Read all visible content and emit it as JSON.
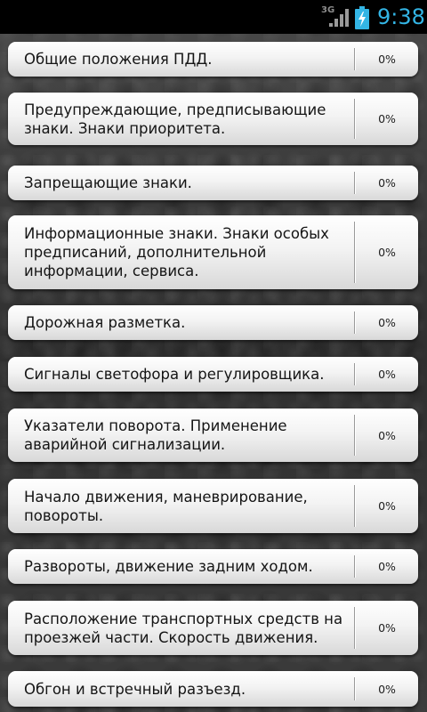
{
  "status_bar": {
    "network": "3G",
    "time": "9:38",
    "signal_icon": "signal-bars-icon",
    "battery_icon": "battery-charging-icon",
    "accent_color": "#33b5e5"
  },
  "topics": [
    {
      "title": "Общие положения ПДД.",
      "progress": "0%"
    },
    {
      "title": "Предупреждающие, предписывающие знаки. Знаки приоритета.",
      "progress": "0%"
    },
    {
      "title": "Запрещающие знаки.",
      "progress": "0%"
    },
    {
      "title": "Информационные знаки. Знаки особых предписаний, дополнительной информации, сервиса.",
      "progress": "0%"
    },
    {
      "title": "Дорожная разметка.",
      "progress": "0%"
    },
    {
      "title": "Сигналы светофора и регулировщика.",
      "progress": "0%"
    },
    {
      "title": "Указатели поворота. Применение аварийной сигнализации.",
      "progress": "0%"
    },
    {
      "title": "Начало движения, маневрирование, повороты.",
      "progress": "0%"
    },
    {
      "title": "Развороты, движение задним ходом.",
      "progress": "0%"
    },
    {
      "title": "Расположение транспортных средств на проезжей части. Скорость движения.",
      "progress": "0%"
    },
    {
      "title": "Обгон и встречный разъезд.",
      "progress": "0%"
    }
  ]
}
